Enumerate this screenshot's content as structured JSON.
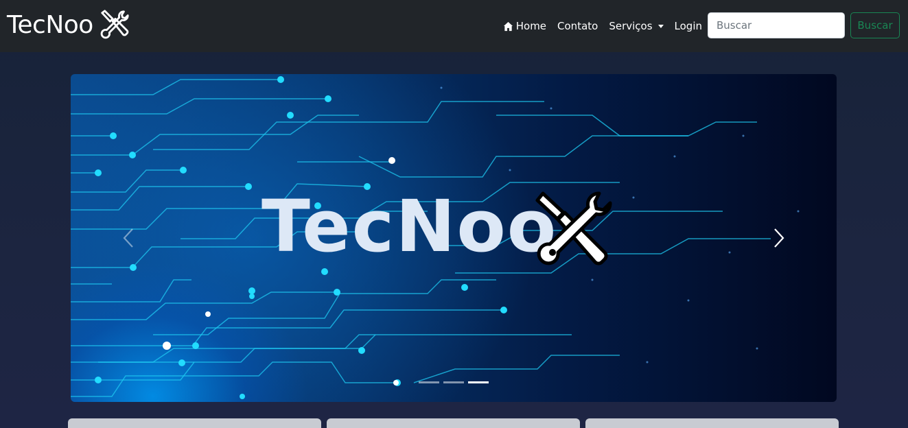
{
  "navbar": {
    "brand": "TecNoo",
    "brand_icon": "wrench-screwdriver-icon",
    "links": [
      {
        "label": "Home",
        "icon": "home-icon"
      },
      {
        "label": "Contato"
      },
      {
        "label": "Serviços",
        "dropdown": true
      },
      {
        "label": "Login"
      }
    ],
    "search": {
      "placeholder": "Buscar",
      "value": "",
      "button_label": "Buscar"
    }
  },
  "carousel": {
    "slide_title": "TecNoo",
    "slide_icon": "wrench-screwdriver-icon",
    "active_slide": 3,
    "slide_count": 3,
    "prev_icon": "chevron-left-icon",
    "next_icon": "chevron-right-icon"
  },
  "cards": [
    {},
    {},
    {}
  ],
  "colors": {
    "navbar_bg": "#212529",
    "page_bg": "#1c2540",
    "search_button": "#198754",
    "circuit": "#1ec8f0"
  }
}
